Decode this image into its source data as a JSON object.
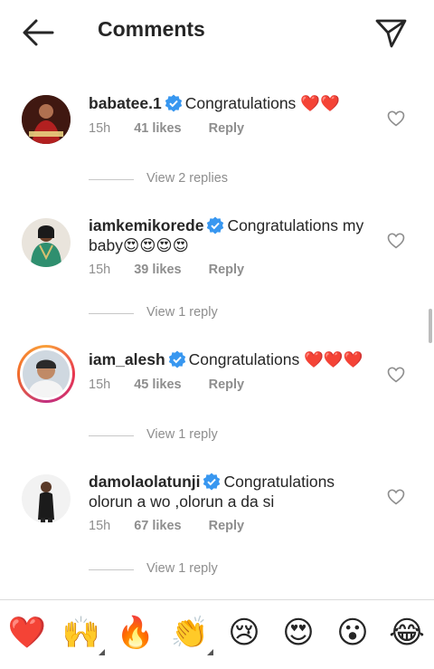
{
  "header": {
    "title": "Comments",
    "back_icon": "arrow-left-icon",
    "send_icon": "paper-plane-icon"
  },
  "comments": [
    {
      "username": "babatee.1",
      "verified": true,
      "text": "Congratulations ❤️❤️",
      "time": "15h",
      "likes": "41 likes",
      "reply": "Reply",
      "view_replies": "View 2 replies"
    },
    {
      "username": "iamkemikorede",
      "verified": true,
      "text": "Congratulations my baby😍😍😍😍",
      "time": "15h",
      "likes": "39 likes",
      "reply": "Reply",
      "view_replies": "View 1 reply"
    },
    {
      "username": "iam_alesh",
      "verified": true,
      "text": "Congratulations ❤️❤️❤️",
      "time": "15h",
      "likes": "45 likes",
      "reply": "Reply",
      "view_replies": "View 1 reply"
    },
    {
      "username": "damolaolatunji",
      "verified": true,
      "text": "Congratulations olorun a wo ,olorun a da si",
      "time": "15h",
      "likes": "67 likes",
      "reply": "Reply",
      "view_replies": "View 1 reply"
    }
  ],
  "emoji_bar": [
    "❤️",
    "🙌",
    "🔥",
    "👏",
    "😢",
    "😍",
    "😮",
    "😂"
  ],
  "colors": {
    "verified": "#3897f0",
    "muted": "#8e8e8e",
    "text": "#262626"
  }
}
